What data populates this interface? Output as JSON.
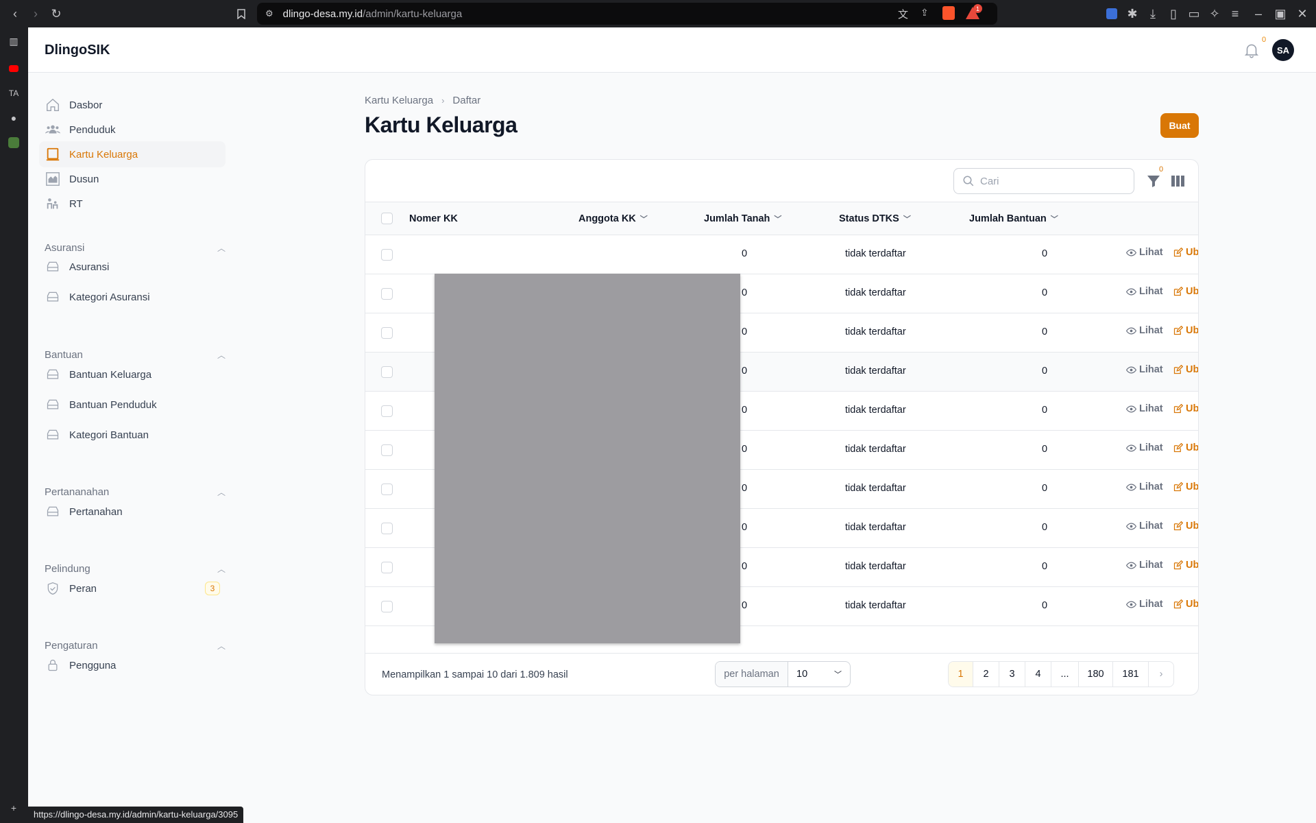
{
  "browser": {
    "url_host": "dlingo-desa.my.id",
    "url_path": "/admin/kartu-keluarga",
    "left_tab_label": "TA",
    "status_url": "https://dlingo-desa.my.id/admin/kartu-keluarga/3095",
    "ext_badge": "1"
  },
  "app": {
    "brand": "DlingoSIK",
    "notification_count": "0",
    "avatar_initials": "SA"
  },
  "sidebar": {
    "top_items": [
      {
        "label": "Dasbor",
        "icon": "home-icon"
      },
      {
        "label": "Penduduk",
        "icon": "users-icon"
      },
      {
        "label": "Kartu Keluarga",
        "icon": "card-icon",
        "active": true
      },
      {
        "label": "Dusun",
        "icon": "village-icon"
      },
      {
        "label": "RT",
        "icon": "people-icon"
      }
    ],
    "groups": [
      {
        "label": "Asuransi",
        "items": [
          "Asuransi",
          "Kategori Asuransi"
        ]
      },
      {
        "label": "Bantuan",
        "items": [
          "Bantuan Keluarga",
          "Bantuan Penduduk",
          "Kategori Bantuan"
        ]
      },
      {
        "label": "Pertananahan",
        "items": [
          "Pertanahan"
        ]
      },
      {
        "label": "Pelindung",
        "items": [
          "Peran"
        ],
        "badge": "3"
      },
      {
        "label": "Pengaturan",
        "items": [
          "Pengguna"
        ]
      }
    ]
  },
  "breadcrumb": {
    "parent": "Kartu Keluarga",
    "current": "Daftar"
  },
  "page": {
    "title": "Kartu Keluarga",
    "create_label": "Buat"
  },
  "table": {
    "search_placeholder": "Cari",
    "filter_count": "0",
    "headers": {
      "nomor_kk": "Nomer KK",
      "anggota": "Anggota KK",
      "tanah": "Jumlah Tanah",
      "dtks": "Status DTKS",
      "bantuan": "Jumlah Bantuan"
    },
    "view_label": "Lihat",
    "edit_label": "Ubah",
    "rows": [
      {
        "tanah": "0",
        "dtks": "tidak terdaftar",
        "bantuan": "0"
      },
      {
        "tanah": "0",
        "dtks": "tidak terdaftar",
        "bantuan": "0"
      },
      {
        "tanah": "0",
        "dtks": "tidak terdaftar",
        "bantuan": "0"
      },
      {
        "tanah": "0",
        "dtks": "tidak terdaftar",
        "bantuan": "0"
      },
      {
        "tanah": "0",
        "dtks": "tidak terdaftar",
        "bantuan": "0"
      },
      {
        "tanah": "0",
        "dtks": "tidak terdaftar",
        "bantuan": "0"
      },
      {
        "tanah": "0",
        "dtks": "tidak terdaftar",
        "bantuan": "0"
      },
      {
        "tanah": "0",
        "dtks": "tidak terdaftar",
        "bantuan": "0"
      },
      {
        "tanah": "0",
        "dtks": "tidak terdaftar",
        "bantuan": "0"
      },
      {
        "tanah": "0",
        "dtks": "tidak terdaftar",
        "bantuan": "0"
      }
    ],
    "summary": "Menampilkan 1 sampai 10 dari 1.809 hasil",
    "per_page_label": "per halaman",
    "per_page_value": "10",
    "pages": [
      "1",
      "2",
      "3",
      "4",
      "...",
      "180",
      "181"
    ],
    "current_page": "1"
  },
  "colors": {
    "accent": "#d97706",
    "browser_chrome": "#1f2023"
  }
}
